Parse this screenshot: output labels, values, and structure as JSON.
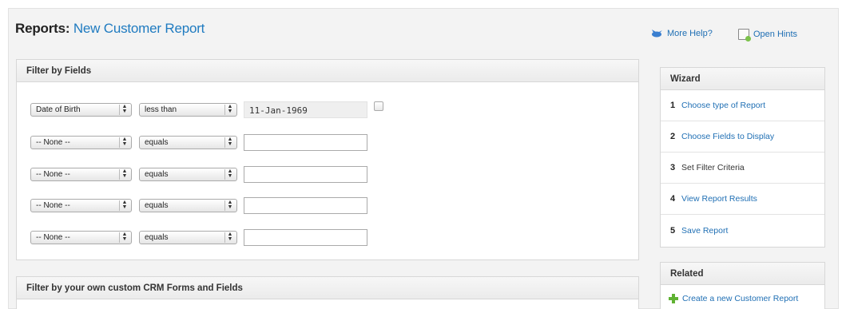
{
  "header": {
    "section": "Reports",
    "separator": ":",
    "page_name": "New Customer Report",
    "more_help": "More Help?",
    "open_hints": "Open Hints"
  },
  "filter_panel": {
    "title": "Filter by Fields",
    "rows": [
      {
        "field": "Date of Birth",
        "operator": "less than",
        "value": "11-Jan-1969",
        "has_checkbox": true
      },
      {
        "field": "-- None --",
        "operator": "equals",
        "value": ""
      },
      {
        "field": "-- None --",
        "operator": "equals",
        "value": ""
      },
      {
        "field": "-- None --",
        "operator": "equals",
        "value": ""
      },
      {
        "field": "-- None --",
        "operator": "equals",
        "value": ""
      }
    ]
  },
  "custom_panel": {
    "title": "Filter by your own custom CRM Forms and Fields"
  },
  "wizard": {
    "title": "Wizard",
    "steps": [
      {
        "num": "1",
        "label": "Choose type of Report"
      },
      {
        "num": "2",
        "label": "Choose Fields to Display"
      },
      {
        "num": "3",
        "label": "Set Filter Criteria"
      },
      {
        "num": "4",
        "label": "View Report Results"
      },
      {
        "num": "5",
        "label": "Save Report"
      }
    ]
  },
  "related": {
    "title": "Related",
    "items": [
      {
        "label": "Create a new Customer Report",
        "icon": "plus-icon"
      }
    ]
  },
  "colors": {
    "link": "#1f6fb4",
    "accent_green": "#5fb233",
    "panel_border": "#d7d7d7"
  }
}
